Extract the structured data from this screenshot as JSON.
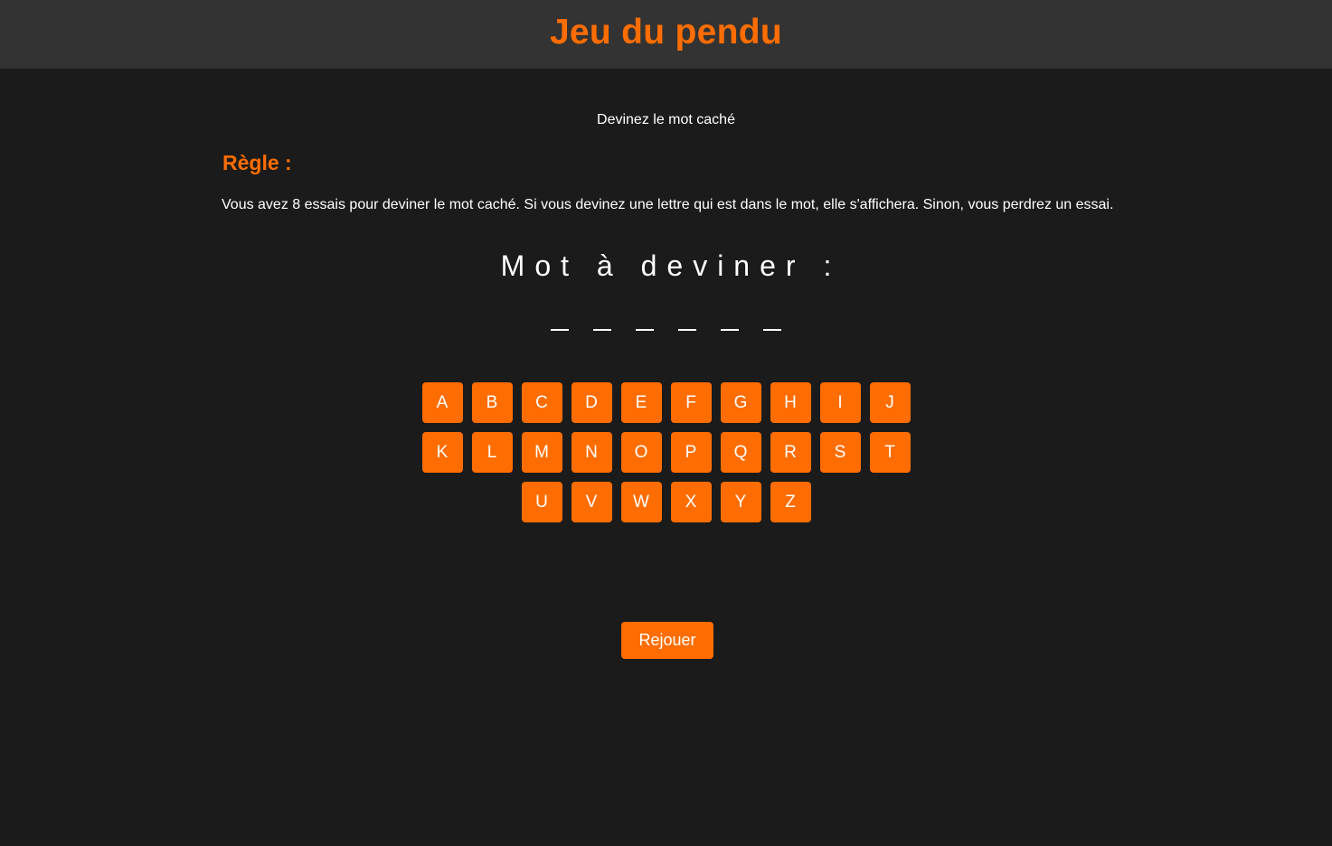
{
  "header": {
    "title": "Jeu du pendu"
  },
  "intro": {
    "subtitle": "Devinez le mot caché"
  },
  "rules": {
    "heading": "Règle :",
    "text": "Vous avez 8 essais pour deviner le mot caché. Si vous devinez une lettre qui est dans le mot, elle s'affichera. Sinon, vous perdrez un essai."
  },
  "word": {
    "label": "Mot à deviner :",
    "slot_count": 6
  },
  "keyboard": {
    "rows": [
      [
        "A",
        "B",
        "C",
        "D",
        "E",
        "F",
        "G",
        "H",
        "I",
        "J"
      ],
      [
        "K",
        "L",
        "M",
        "N",
        "O",
        "P",
        "Q",
        "R",
        "S",
        "T"
      ],
      [
        "U",
        "V",
        "W",
        "X",
        "Y",
        "Z"
      ]
    ]
  },
  "actions": {
    "replay_label": "Rejouer"
  },
  "colors": {
    "accent": "#ff6d00",
    "background": "#1b1b1b",
    "header_background": "#333333"
  }
}
